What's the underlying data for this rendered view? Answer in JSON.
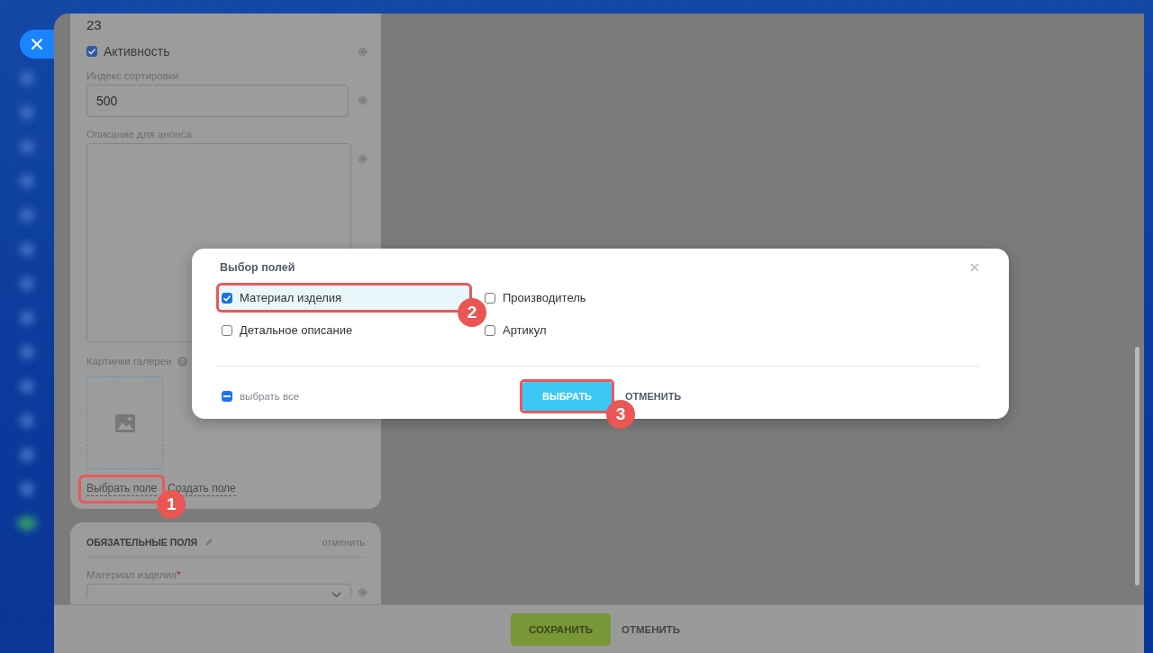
{
  "form": {
    "sort_number": "23",
    "active": {
      "label": "Активность",
      "checked": true
    },
    "fields": [
      {
        "label": "Индекс сортировки",
        "kind": "input",
        "value": "500"
      },
      {
        "label": "Описание для анонса",
        "kind": "textarea"
      }
    ],
    "gallery": {
      "label": "Картинки галереи"
    },
    "links": [
      {
        "label": "Выбрать поле",
        "step": "1"
      },
      {
        "label": "Создать поле"
      }
    ]
  },
  "required_section": {
    "title": "ОБЯЗАТЕЛЬНЫЕ ПОЛЯ",
    "action": "отменить",
    "fields": [
      {
        "label": "Материал изделия",
        "required_mark": "*"
      }
    ]
  },
  "footer": {
    "buttons": [
      {
        "label": "СОХРАНИТЬ",
        "kind": "primary"
      },
      {
        "label": "ОТМЕНИТЬ",
        "kind": "link"
      }
    ]
  },
  "dialog": {
    "title": "Выбор полей",
    "options": [
      {
        "label": "Материал изделия",
        "checked": true,
        "step": "2"
      },
      {
        "label": "Производитель",
        "checked": false
      },
      {
        "label": "Детальное описание",
        "checked": false
      },
      {
        "label": "Артикул",
        "checked": false
      }
    ],
    "select_all": {
      "label": "выбрать все",
      "indeterminate": true
    },
    "buttons": [
      {
        "label": "ВЫБРАТЬ",
        "kind": "primary",
        "step": "3"
      },
      {
        "label": "ОТМЕНИТЬ",
        "kind": "link"
      }
    ]
  }
}
